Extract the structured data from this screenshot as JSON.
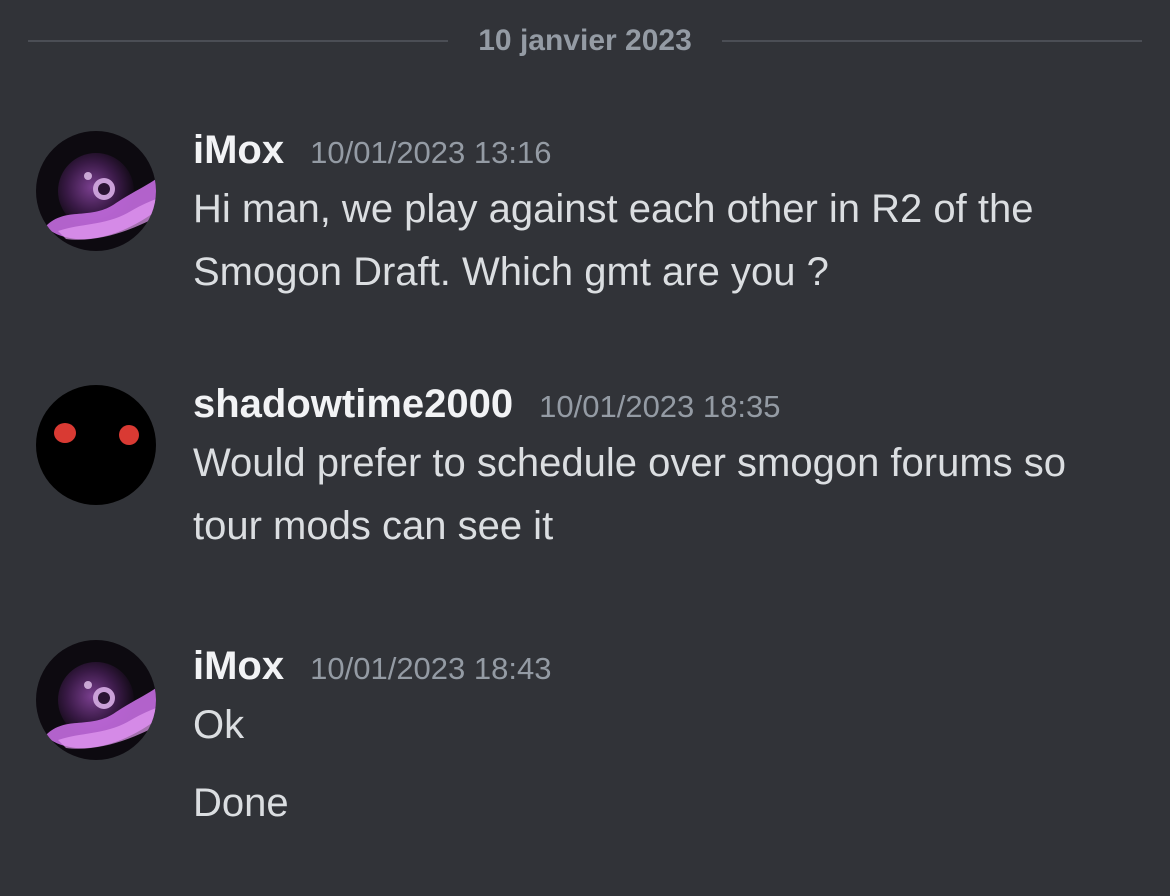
{
  "date_divider": "10 janvier 2023",
  "colors": {
    "background": "#313338",
    "username": "#f2f3f5",
    "timestamp": "#949ba4",
    "message_text": "#dbdee1",
    "divider_line": "#4b4e55",
    "shadow_avatar_eyes": "#d93a33"
  },
  "messages": [
    {
      "username": "iMox",
      "timestamp": "10/01/2023 13:16",
      "avatar": "purple-ball-avatar",
      "lines": [
        "Hi man, we play against each other in R2 of the Smogon Draft. Which gmt are you ?"
      ]
    },
    {
      "username": "shadowtime2000",
      "timestamp": "10/01/2023 18:35",
      "avatar": "red-eyes-avatar",
      "lines": [
        "Would prefer to schedule over smogon forums so tour mods can see it"
      ]
    },
    {
      "username": "iMox",
      "timestamp": "10/01/2023 18:43",
      "avatar": "purple-ball-avatar",
      "lines": [
        "Ok",
        "Done"
      ]
    }
  ]
}
